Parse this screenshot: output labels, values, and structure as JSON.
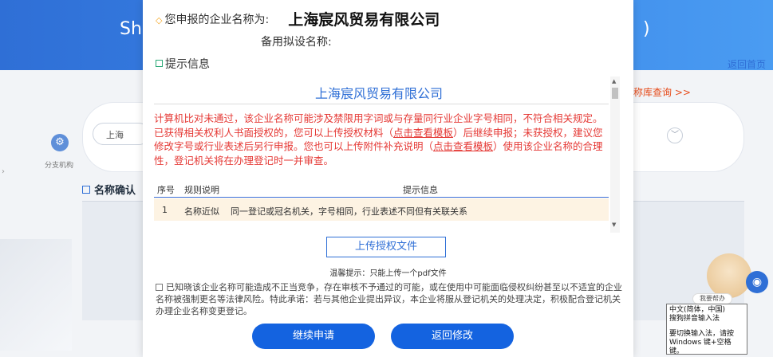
{
  "background": {
    "title_left": "Sh",
    "title_right": ")",
    "back_home": "返回首页",
    "name_query": "称库查询 >>",
    "region": "上海",
    "org_label": "分支机构",
    "section_title": "名称确认",
    "left_arrow": "›"
  },
  "modal": {
    "company_label": "您申报的企业名称为:",
    "company_name": "上海宸风贸易有限公司",
    "alt_name_label": "备用拟设名称:",
    "tip_title": "提示信息",
    "tip_company": "上海宸风贸易有限公司",
    "warning_1": "计算机比对未通过，该企业名称可能涉及禁限用字词或与存量同行业企业字号相同，不符合相关规定。已获得相关权利人书面授权的，您可以上传授权材料（",
    "warning_link_1": "点击查看模板",
    "warning_2": "）后继续申报；未获授权，建议您修改字号或行业表述后另行申报。您也可以上传附件补充说明（",
    "warning_link_2": "点击查看模板",
    "warning_3": "）使用该企业名称的合理性，登记机关将在办理登记时一并审查。",
    "table": {
      "headers": [
        "序号",
        "规则说明",
        "提示信息"
      ],
      "rows": [
        {
          "no": "1",
          "rule": "名称近似",
          "info": "同一登记或冠名机关，字号相同，行业表述不同但有关联关系"
        }
      ]
    },
    "upload_button": "上传授权文件",
    "upload_note": "温馨提示：只能上传一个pdf文件",
    "agreement": "已知晓该企业名称可能造成不正当竞争，存在审核不予通过的可能，或在使用中可能面临侵权纠纷甚至以不适宜的企业名称被强制更名等法律风险。特此承诺：若与其他企业提出异议，本企业将服从登记机关的处理决定，积极配合登记机关办理企业名称变更登记。",
    "continue_button": "继续申请",
    "back_button": "返回修改"
  },
  "widgets": {
    "assistant_label": "我要帮办",
    "ime_line_1": "中文(简体，中国)",
    "ime_line_2": "搜狗拼音输入法",
    "ime_line_3": "要切换输入法，请按",
    "ime_line_4": "Windows 键+空格键。"
  },
  "colors": {
    "accent": "#1463e0",
    "warning": "#e53935",
    "highlight_row": "#fdf3e3"
  }
}
